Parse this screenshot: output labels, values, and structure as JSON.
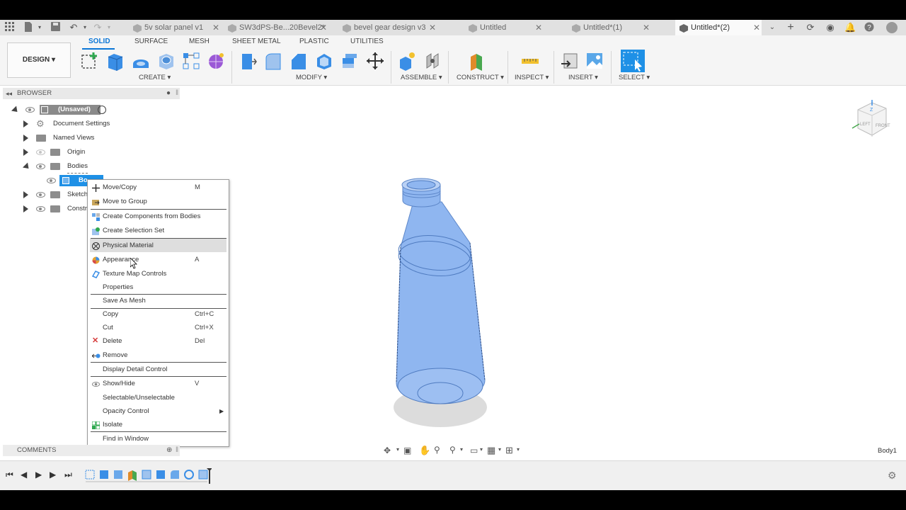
{
  "tabs": [
    {
      "label": "5v solar panel v1",
      "active": false
    },
    {
      "label": "SW3dPS-Be...20Bevel2*",
      "active": false
    },
    {
      "label": "bevel gear design v3",
      "active": false
    },
    {
      "label": "Untitled",
      "active": false
    },
    {
      "label": "Untitled*(1)",
      "active": false
    },
    {
      "label": "Untitled*(2)",
      "active": true
    }
  ],
  "toolbar": {
    "workspace": "DESIGN ▾",
    "tabs": [
      "SOLID",
      "SURFACE",
      "MESH",
      "SHEET METAL",
      "PLASTIC",
      "UTILITIES"
    ],
    "groups": [
      "CREATE ▾",
      "MODIFY ▾",
      "ASSEMBLE ▾",
      "CONSTRUCT ▾",
      "INSPECT ▾",
      "INSERT ▾",
      "SELECT ▾"
    ]
  },
  "browser": {
    "title": "BROWSER",
    "root": "(Unsaved)",
    "items": [
      "Document Settings",
      "Named Views",
      "Origin",
      "Bodies",
      "Body1",
      "Sketches",
      "Construction"
    ],
    "item_visible_text": {
      "body": "Bo",
      "sketches": "Sketch",
      "construction": "Constr"
    }
  },
  "context_menu": {
    "items": [
      {
        "label": "Move/Copy",
        "shortcut": "M"
      },
      {
        "label": "Move to Group",
        "shortcut": ""
      },
      {
        "label": "Create Components from Bodies",
        "shortcut": ""
      },
      {
        "label": "Create Selection Set",
        "shortcut": ""
      },
      {
        "label": "Physical Material",
        "shortcut": ""
      },
      {
        "label": "Appearance",
        "shortcut": "A"
      },
      {
        "label": "Texture Map Controls",
        "shortcut": ""
      },
      {
        "label": "Properties",
        "shortcut": ""
      },
      {
        "label": "Save As Mesh",
        "shortcut": ""
      },
      {
        "label": "Copy",
        "shortcut": "Ctrl+C"
      },
      {
        "label": "Cut",
        "shortcut": "Ctrl+X"
      },
      {
        "label": "Delete",
        "shortcut": "Del"
      },
      {
        "label": "Remove",
        "shortcut": ""
      },
      {
        "label": "Display Detail Control",
        "shortcut": ""
      },
      {
        "label": "Show/Hide",
        "shortcut": "V"
      },
      {
        "label": "Selectable/Unselectable",
        "shortcut": ""
      },
      {
        "label": "Opacity Control",
        "shortcut": ""
      },
      {
        "label": "Isolate",
        "shortcut": ""
      },
      {
        "label": "Find in Window",
        "shortcut": ""
      }
    ],
    "highlighted": "Physical Material"
  },
  "viewcube": {
    "left": "LEFT",
    "front": "FRONT",
    "axis_z": "Z"
  },
  "comments": {
    "title": "COMMENTS"
  },
  "status": {
    "selection": "Body1"
  },
  "colors": {
    "accent": "#0b76d6",
    "body": "#8fb6f0",
    "selection": "#1e90e6"
  }
}
